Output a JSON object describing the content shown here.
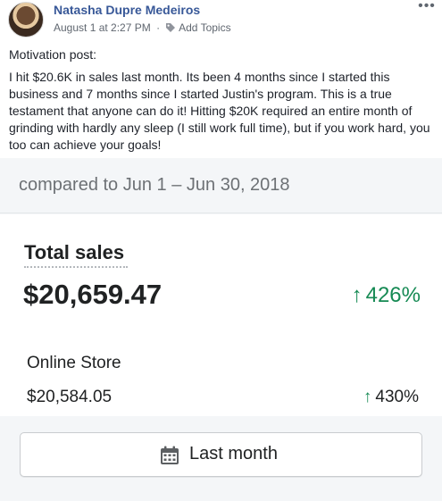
{
  "post": {
    "author": "Natasha Dupre Medeiros",
    "timestamp": "August 1 at 2:27 PM",
    "separator": "·",
    "add_topics": "Add Topics",
    "more_menu": "•••",
    "paragraphs": [
      "Motivation post:",
      "I hit $20.6K in sales last month. Its been 4 months since I started this business and 7 months since I started Justin's program. This is a true testament that anyone can do it! Hitting $20K required an entire month of grinding with hardly any sleep (I still work full time), but if you work hard, you too can achieve your goals!"
    ]
  },
  "screenshot": {
    "compare_text": "compared to Jun 1 – Jun 30, 2018",
    "total_sales": {
      "label": "Total sales",
      "value": "$20,659.47",
      "change": "426%"
    },
    "online_store": {
      "label": "Online Store",
      "value": "$20,584.05",
      "change": "430%"
    },
    "date_range_button": "Last month",
    "arrow_glyph": "↑"
  },
  "colors": {
    "author_link": "#385898",
    "positive_green": "#168a54",
    "band_gray": "#f4f6f8"
  },
  "icons": {
    "tag": "tag-icon",
    "calendar": "calendar-icon",
    "more": "more-options-icon"
  }
}
